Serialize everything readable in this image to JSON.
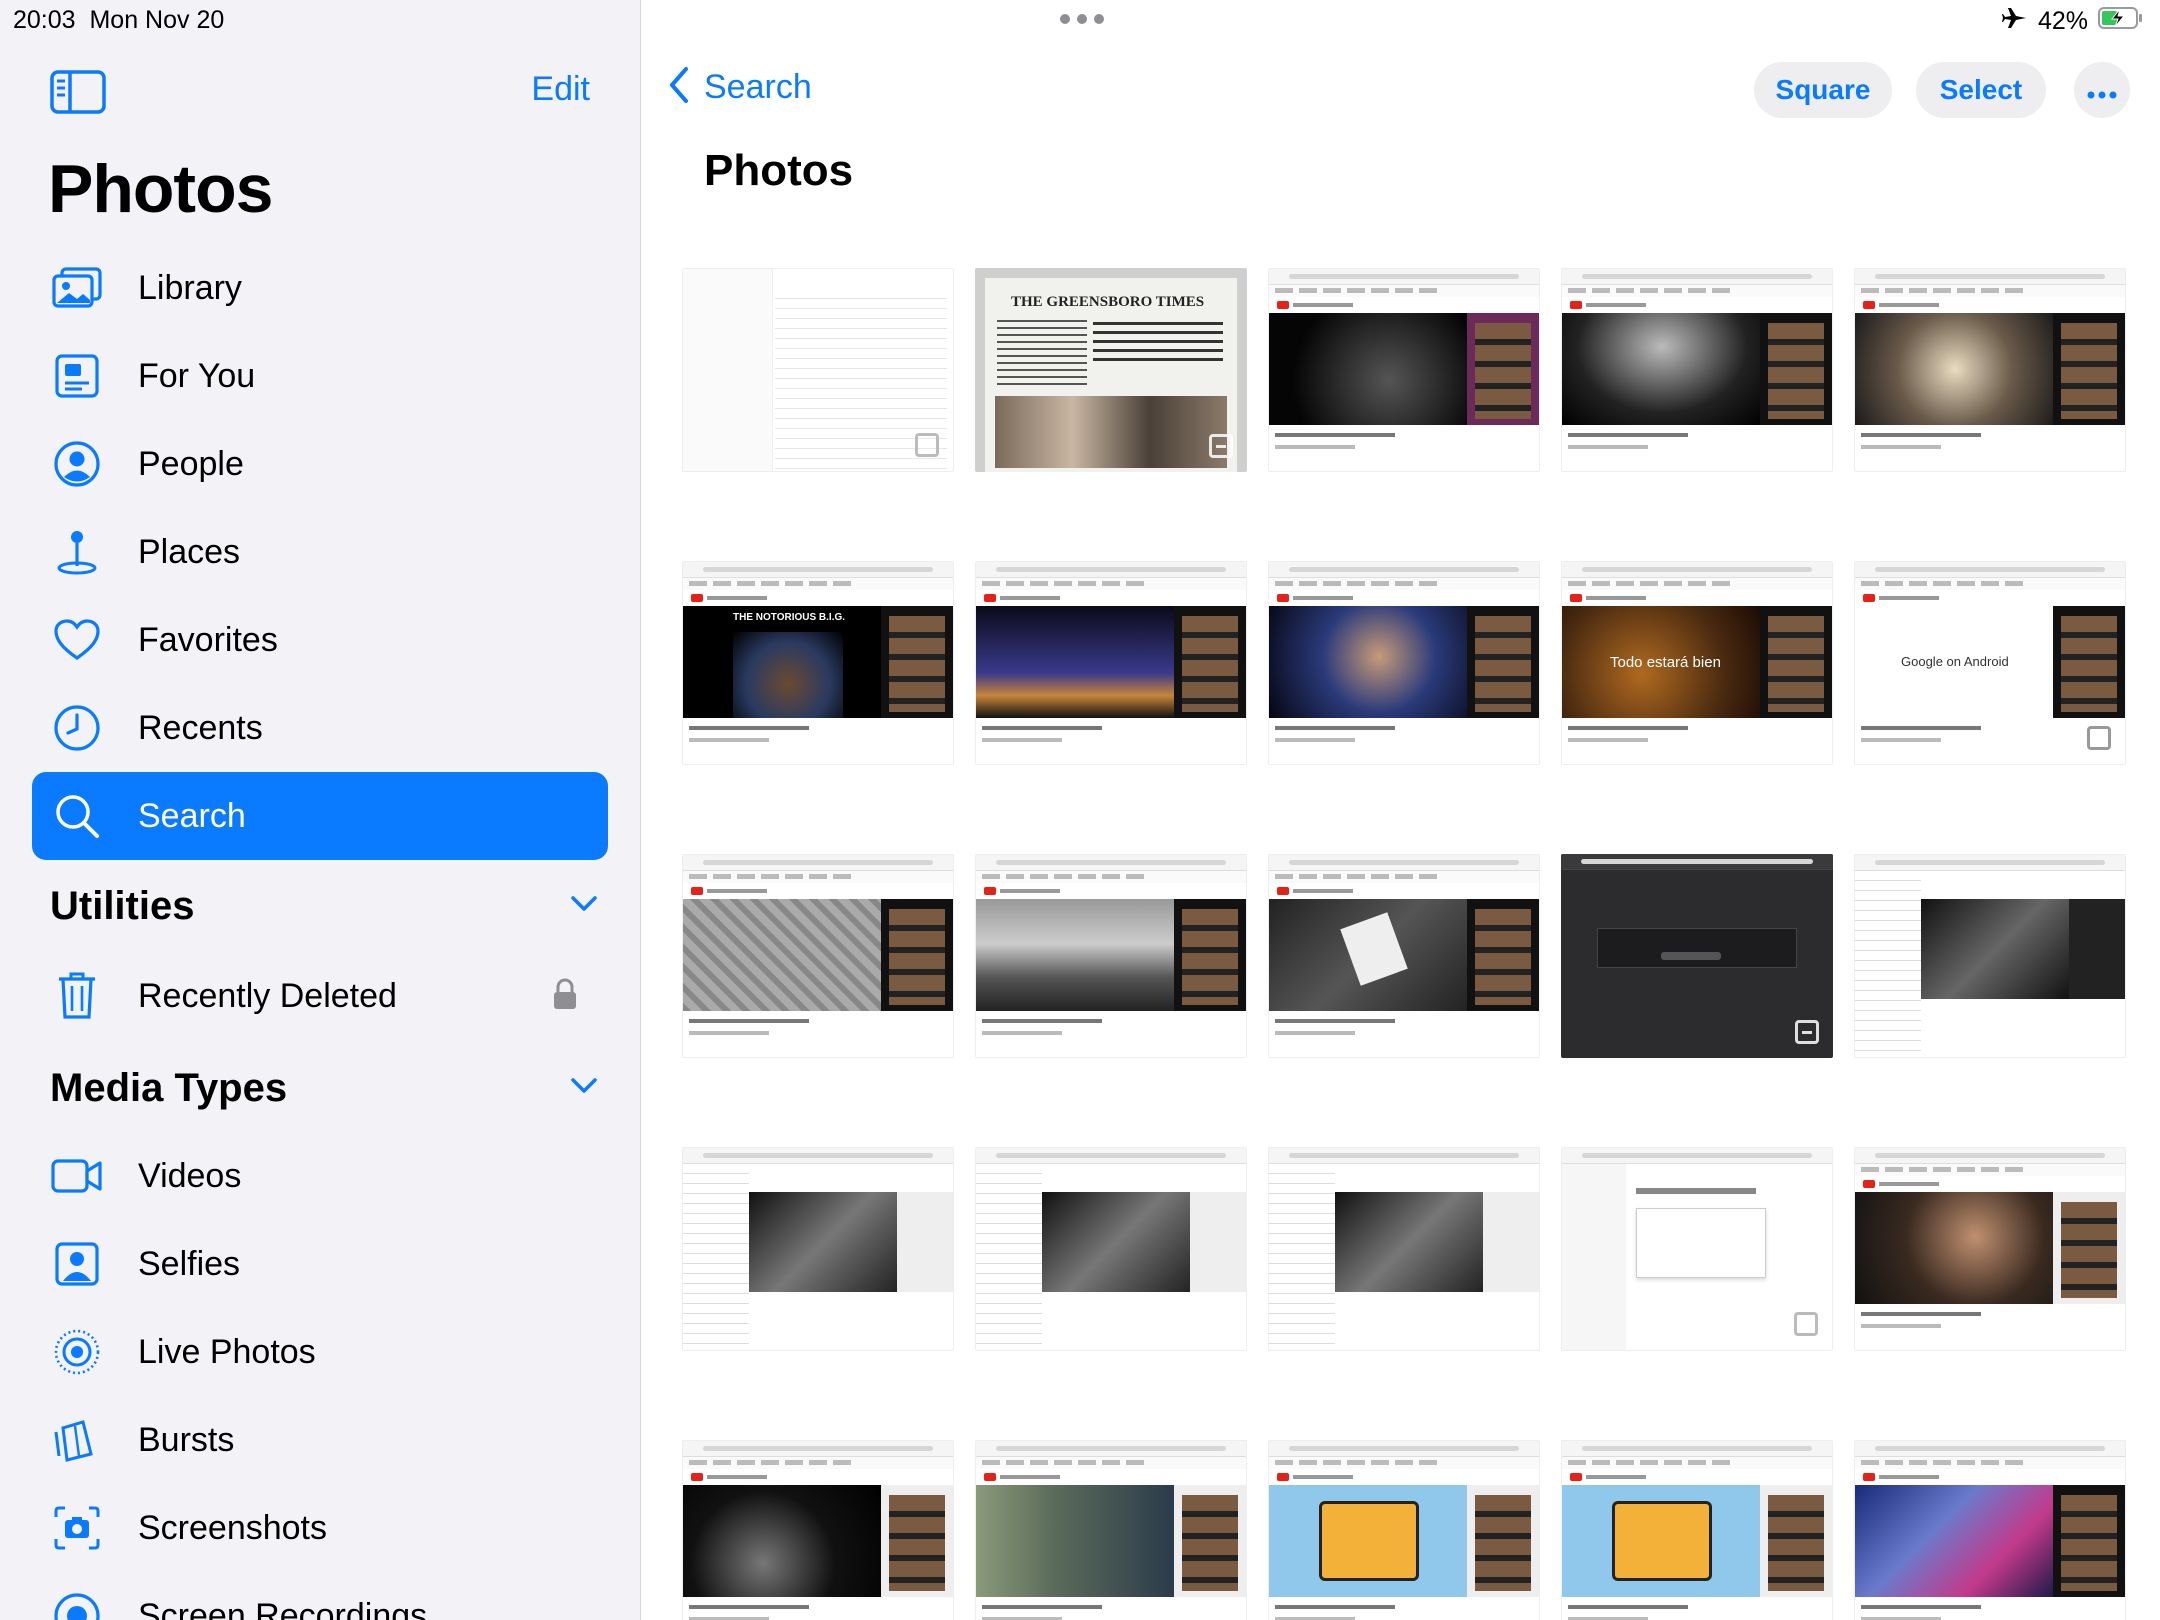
{
  "status_bar": {
    "time": "20:03",
    "date": "Mon Nov 20",
    "battery": "42%"
  },
  "sidebar": {
    "edit_label": "Edit",
    "title": "Photos",
    "items": [
      {
        "label": "Library",
        "icon": "library-icon"
      },
      {
        "label": "For You",
        "icon": "for-you-icon"
      },
      {
        "label": "People",
        "icon": "people-icon"
      },
      {
        "label": "Places",
        "icon": "places-icon"
      },
      {
        "label": "Favorites",
        "icon": "heart-icon"
      },
      {
        "label": "Recents",
        "icon": "clock-icon"
      },
      {
        "label": "Search",
        "icon": "search-icon",
        "selected": true
      }
    ],
    "utilities": {
      "title": "Utilities",
      "items": [
        {
          "label": "Recently Deleted",
          "icon": "trash-icon",
          "locked": true
        }
      ]
    },
    "media_types": {
      "title": "Media Types",
      "items": [
        {
          "label": "Videos",
          "icon": "video-icon"
        },
        {
          "label": "Selfies",
          "icon": "selfie-icon"
        },
        {
          "label": "Live Photos",
          "icon": "live-photo-icon"
        },
        {
          "label": "Bursts",
          "icon": "bursts-icon"
        },
        {
          "label": "Screenshots",
          "icon": "screenshot-icon"
        },
        {
          "label": "Screen Recordings",
          "icon": "screen-recording-icon"
        }
      ]
    }
  },
  "main": {
    "back_label": "Search",
    "square_label": "Square",
    "select_label": "Select",
    "title": "Photos",
    "thumbnails": [
      {
        "kind": "settings",
        "caption": ""
      },
      {
        "kind": "newspaper",
        "caption": "THE GREENSBORO TIMES"
      },
      {
        "kind": "youtube",
        "caption": ""
      },
      {
        "kind": "youtube",
        "caption": ""
      },
      {
        "kind": "youtube",
        "caption": ""
      },
      {
        "kind": "youtube",
        "caption": "THE NOTORIOUS B.I.G."
      },
      {
        "kind": "youtube",
        "caption": ""
      },
      {
        "kind": "youtube",
        "caption": ""
      },
      {
        "kind": "youtube",
        "caption": "Todo estará bien"
      },
      {
        "kind": "youtube",
        "caption": "Google on Android"
      },
      {
        "kind": "youtube",
        "caption": ""
      },
      {
        "kind": "youtube",
        "caption": ""
      },
      {
        "kind": "youtube",
        "caption": ""
      },
      {
        "kind": "drive-dark",
        "caption": ""
      },
      {
        "kind": "youtube",
        "caption": ""
      },
      {
        "kind": "youtube",
        "caption": ""
      },
      {
        "kind": "youtube",
        "caption": ""
      },
      {
        "kind": "youtube",
        "caption": ""
      },
      {
        "kind": "drive",
        "caption": ""
      },
      {
        "kind": "youtube",
        "caption": ""
      },
      {
        "kind": "youtube",
        "caption": ""
      },
      {
        "kind": "youtube",
        "caption": ""
      },
      {
        "kind": "youtube",
        "caption": ""
      },
      {
        "kind": "youtube",
        "caption": ""
      },
      {
        "kind": "youtube",
        "caption": ""
      }
    ]
  },
  "colors": {
    "accent": "#0a7aff",
    "sidebar_bg": "#f2f2f7"
  }
}
